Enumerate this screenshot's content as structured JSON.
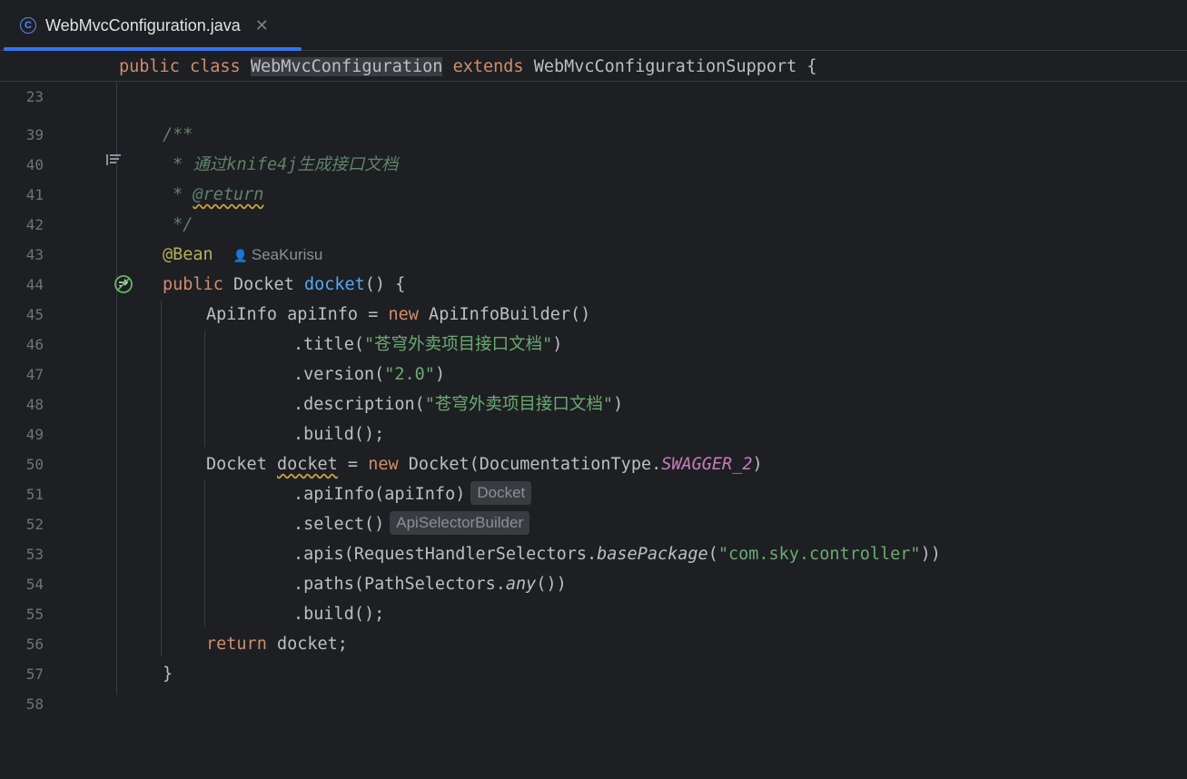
{
  "tab": {
    "icon": "class-icon",
    "icon_glyph": "C",
    "title": "WebMvcConfiguration.java",
    "close": "✕",
    "accent": "#3574f0"
  },
  "sticky_line": {
    "number": "23",
    "kw_public": "public",
    "kw_class": "class",
    "class_name": "WebMvcConfiguration",
    "kw_extends": "extends",
    "super_class": "WebMvcConfigurationSupport",
    "brace": " {"
  },
  "lines": {
    "l39": {
      "number": "39"
    },
    "l40": {
      "number": "40",
      "text": "/**"
    },
    "l41": {
      "number": "41",
      "text": " * 通过knife4j生成接口文档"
    },
    "l42": {
      "number": "42",
      "prefix": " * ",
      "tag": "@return"
    },
    "l43": {
      "number": "43",
      "text": " */"
    },
    "l44": {
      "number": "44",
      "annotation": "@Bean",
      "author": "SeaKurisu"
    },
    "l45": {
      "number": "45",
      "kw": "public",
      "type": "Docket",
      "method": "docket",
      "rest": "() {"
    },
    "l46": {
      "number": "46",
      "type": "ApiInfo",
      "var": "apiInfo",
      "eq": " = ",
      "kw_new": "new",
      "ctor": " ApiInfoBuilder()"
    },
    "l47": {
      "number": "47",
      "call": ".title(",
      "str": "\"苍穹外卖项目接口文档\"",
      "close": ")"
    },
    "l48": {
      "number": "48",
      "call": ".version(",
      "str": "\"2.0\"",
      "close": ")"
    },
    "l49": {
      "number": "49",
      "call": ".description(",
      "str": "\"苍穹外卖项目接口文档\"",
      "close": ")"
    },
    "l50": {
      "number": "50",
      "text": ".build();"
    },
    "l51": {
      "number": "51",
      "type": "Docket ",
      "var": "docket",
      "eq": " = ",
      "kw_new": "new",
      "ctor": " Docket(DocumentationType.",
      "static": "SWAGGER_2",
      "close": ")"
    },
    "l52": {
      "number": "52",
      "text": ".apiInfo(apiInfo)",
      "hint": "Docket"
    },
    "l53": {
      "number": "53",
      "text": ".select()",
      "hint": "ApiSelectorBuilder"
    },
    "l54": {
      "number": "54",
      "call": ".apis(RequestHandlerSelectors.",
      "method": "basePackage",
      "open": "(",
      "str": "\"com.sky.controller\"",
      "close": "))"
    },
    "l55": {
      "number": "55",
      "call": ".paths(PathSelectors.",
      "method": "any",
      "close": "())"
    },
    "l56": {
      "number": "56",
      "text": ".build();"
    },
    "l57": {
      "number": "57",
      "kw": "return",
      "rest": " docket;"
    },
    "l58": {
      "number": "58",
      "text": "}"
    }
  },
  "gutter": {
    "doc_render_icon": "doc-render-toggle-icon",
    "bean_icon": "spring-bean-gutter-icon"
  }
}
